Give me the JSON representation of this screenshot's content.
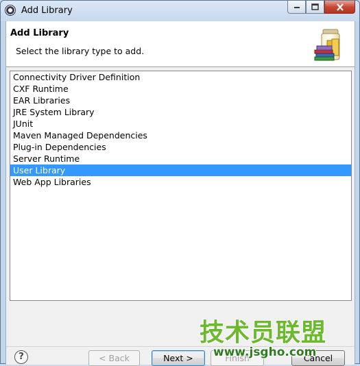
{
  "window": {
    "title": "Add Library",
    "minimize_icon": "minimize-icon",
    "maximize_icon": "maximize-icon",
    "close_icon": "close-icon"
  },
  "banner": {
    "title": "Add Library",
    "message": "Select the library type to add.",
    "icon": "library-jar-books-icon"
  },
  "library_types": [
    {
      "label": "Connectivity Driver Definition",
      "selected": false
    },
    {
      "label": "CXF Runtime",
      "selected": false
    },
    {
      "label": "EAR Libraries",
      "selected": false
    },
    {
      "label": "JRE System Library",
      "selected": false
    },
    {
      "label": "JUnit",
      "selected": false
    },
    {
      "label": "Maven Managed Dependencies",
      "selected": false
    },
    {
      "label": "Plug-in Dependencies",
      "selected": false
    },
    {
      "label": "Server Runtime",
      "selected": false
    },
    {
      "label": "User Library",
      "selected": true
    },
    {
      "label": "Web App Libraries",
      "selected": false
    }
  ],
  "footer": {
    "help_glyph": "?",
    "back_label": "< Back",
    "next_label": "Next >",
    "finish_label": "Finish",
    "cancel_label": "Cancel"
  },
  "watermark": {
    "text": "技术员联盟",
    "url": "www.jsgho.com"
  },
  "colors": {
    "selection": "#3399ff",
    "watermark_green": "#6cb92e"
  }
}
